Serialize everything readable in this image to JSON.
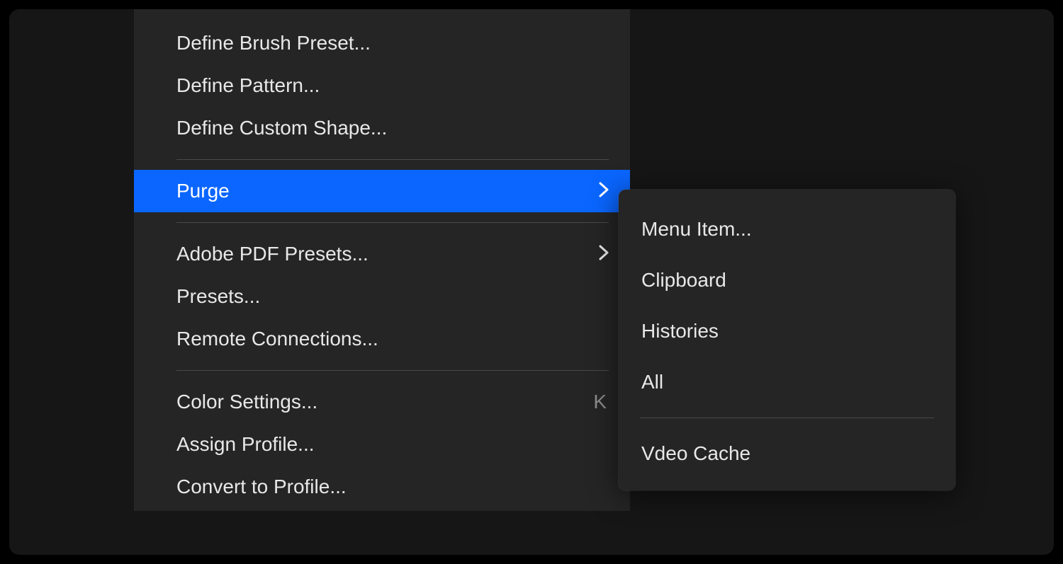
{
  "colors": {
    "highlight": "#0a66ff",
    "panel": "#252525",
    "bg": "#161616"
  },
  "mainMenu": {
    "group1": [
      {
        "label": "Define Brush Preset..."
      },
      {
        "label": "Define Pattern..."
      },
      {
        "label": "Define Custom Shape..."
      }
    ],
    "purge": {
      "label": "Purge",
      "hasSubmenu": true,
      "highlighted": true
    },
    "group2": [
      {
        "label": "Adobe PDF Presets...",
        "hasSubmenu": true
      },
      {
        "label": "Presets..."
      },
      {
        "label": "Remote Connections..."
      }
    ],
    "group3": [
      {
        "label": "Color Settings...",
        "shortcut": "K"
      },
      {
        "label": "Assign Profile..."
      },
      {
        "label": "Convert to Profile..."
      }
    ]
  },
  "submenu": {
    "group1": [
      {
        "label": "Menu Item..."
      },
      {
        "label": "Clipboard"
      },
      {
        "label": "Histories"
      },
      {
        "label": "All"
      }
    ],
    "group2": [
      {
        "label": "Vdeo Cache"
      }
    ]
  }
}
